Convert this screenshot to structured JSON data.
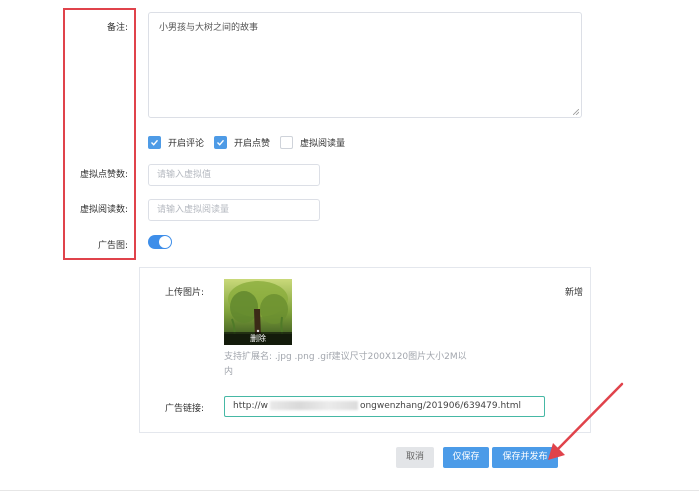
{
  "form": {
    "remark_label": "备注:",
    "remark_value": "小男孩与大树之间的故事",
    "checkboxes": [
      {
        "label": "开启评论",
        "checked": true
      },
      {
        "label": "开启点赞",
        "checked": true
      },
      {
        "label": "虚拟阅读量",
        "checked": false
      }
    ],
    "virtual_likes_label": "虚拟点赞数:",
    "virtual_likes_placeholder": "请输入虚拟值",
    "virtual_reads_label": "虚拟阅读数:",
    "virtual_reads_placeholder": "请输入虚拟阅读量",
    "ad_image_label": "广告图:",
    "ad_image_enabled": true
  },
  "ad_panel": {
    "upload_label": "上传图片:",
    "add_label": "新增",
    "delete_label": "删除",
    "hint": "支持扩展名: .jpg .png .gif建议尺寸200X120图片大小2M以内",
    "link_label": "广告链接:",
    "link_prefix": "http://w",
    "link_suffix": "ongwenzhang/201906/639479.html"
  },
  "actions": {
    "cancel": "取消",
    "save": "仅保存",
    "publish": "保存并发布"
  },
  "colors": {
    "primary": "#4b9be8",
    "highlight": "#e0434b",
    "link_border": "#46b8a5"
  }
}
